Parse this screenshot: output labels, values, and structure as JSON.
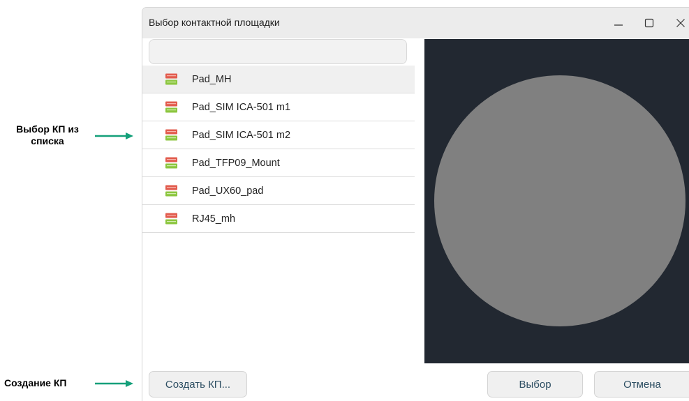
{
  "annotations": {
    "select_from_list": "Выбор КП из списка",
    "select_line1": "Выбор КП из",
    "select_line2": "списка",
    "create": "Создание КП",
    "arrow_color": "#14a07a"
  },
  "dialog": {
    "title": "Выбор контактной площадки",
    "window_buttons": {
      "minimize_icon": "minimize-icon",
      "maximize_icon": "maximize-icon",
      "close_icon": "close-icon"
    },
    "search": {
      "value": "",
      "placeholder": ""
    },
    "pads": [
      {
        "label": "Pad_MH",
        "selected": true
      },
      {
        "label": "Pad_SIM ICA-501 m1",
        "selected": false
      },
      {
        "label": "Pad_SIM ICA-501 m2",
        "selected": false
      },
      {
        "label": "Pad_TFP09_Mount",
        "selected": false
      },
      {
        "label": "Pad_UX60_pad",
        "selected": false
      },
      {
        "label": "RJ45_mh",
        "selected": false
      }
    ],
    "pad_icon": "pad-icon",
    "preview": {
      "shape": "circle",
      "background_color": "#222831",
      "shape_color": "#808080"
    },
    "buttons": {
      "create": "Создать КП...",
      "select": "Выбор",
      "cancel": "Отмена"
    },
    "colors": {
      "button_text": "#2e4f63",
      "titlebar": "#ececec",
      "selected_row": "#f0f0f0"
    }
  }
}
